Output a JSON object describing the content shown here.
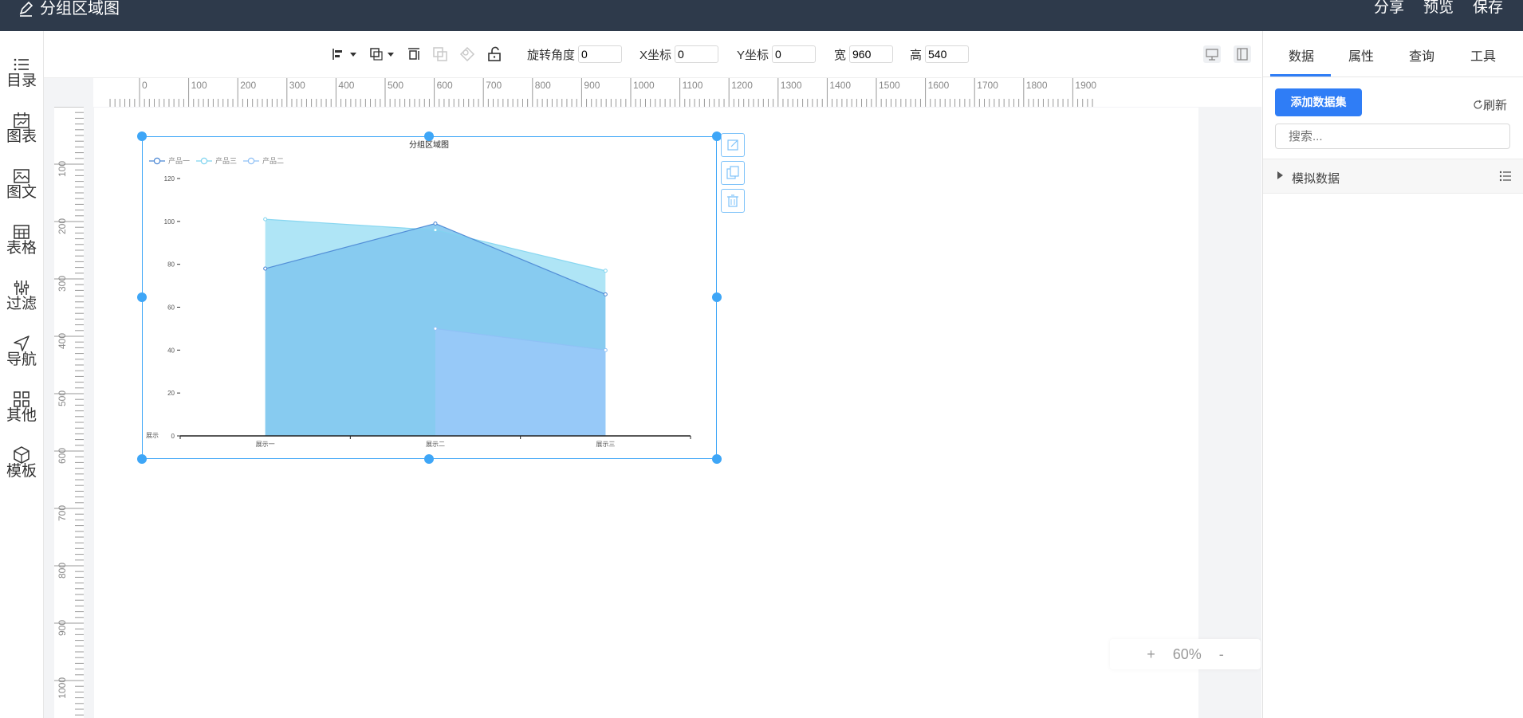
{
  "app": {
    "title": "分组区域图"
  },
  "header": {
    "actions": [
      "分享",
      "预览",
      "保存"
    ]
  },
  "sidebar": {
    "items": [
      {
        "label": "目录",
        "icon": "list-icon"
      },
      {
        "label": "图表",
        "icon": "chart-calendar-icon"
      },
      {
        "label": "图文",
        "icon": "image-text-icon"
      },
      {
        "label": "表格",
        "icon": "table-icon"
      },
      {
        "label": "过滤",
        "icon": "filter-icon"
      },
      {
        "label": "导航",
        "icon": "navigation-icon"
      },
      {
        "label": "其他",
        "icon": "grid-icon"
      },
      {
        "label": "模板",
        "icon": "cube-icon"
      }
    ]
  },
  "toolbar": {
    "fields": [
      {
        "label": "旋转角度",
        "value": "0"
      },
      {
        "label": "X坐标",
        "value": "0"
      },
      {
        "label": "Y坐标",
        "value": "0"
      },
      {
        "label": "宽",
        "value": "960"
      },
      {
        "label": "高",
        "value": "540"
      }
    ]
  },
  "ruler": {
    "h_labels": [
      "0",
      "100",
      "200",
      "300",
      "400",
      "500",
      "600",
      "700",
      "800",
      "900",
      "1000",
      "1100",
      "1200",
      "1300",
      "1400",
      "1500",
      "1600",
      "1700",
      "1800",
      "1900"
    ],
    "v_labels": [
      "100",
      "200",
      "300",
      "400",
      "500",
      "600",
      "700",
      "800",
      "900",
      "1000"
    ]
  },
  "zoom": {
    "plus": "+",
    "level": "60%",
    "minus": "-"
  },
  "right_panel": {
    "tabs": [
      "数据",
      "属性",
      "查询",
      "工具"
    ],
    "active_tab": "数据",
    "add_dataset_label": "添加数据集",
    "refresh_label": "刷新",
    "search_placeholder": "搜索...",
    "dataset_name": "模拟数据"
  },
  "colors": {
    "topbar": "#2e3a4b",
    "accent": "#2f7df6",
    "selection": "#3ea6f7"
  },
  "chart_data": {
    "type": "area",
    "title": "分组区域图",
    "categories": [
      "展示一",
      "展示二",
      "展示三"
    ],
    "xlabel": "展示",
    "ylabel": "",
    "ylim": [
      0,
      120
    ],
    "yticks": [
      0,
      20,
      40,
      60,
      80,
      100,
      120
    ],
    "legend": "top-left",
    "grid": false,
    "series": [
      {
        "name": "产品一",
        "values": [
          78,
          99,
          66
        ],
        "color": "#4a86d4",
        "fill": "#83c8f0"
      },
      {
        "name": "产品三",
        "values": [
          101,
          96,
          77
        ],
        "color": "#7fd4ef",
        "fill": "#a6e2f5"
      },
      {
        "name": "产品二",
        "values": [
          null,
          50,
          40
        ],
        "color": "#8fc0f5",
        "fill": "#99c9f8"
      }
    ]
  }
}
